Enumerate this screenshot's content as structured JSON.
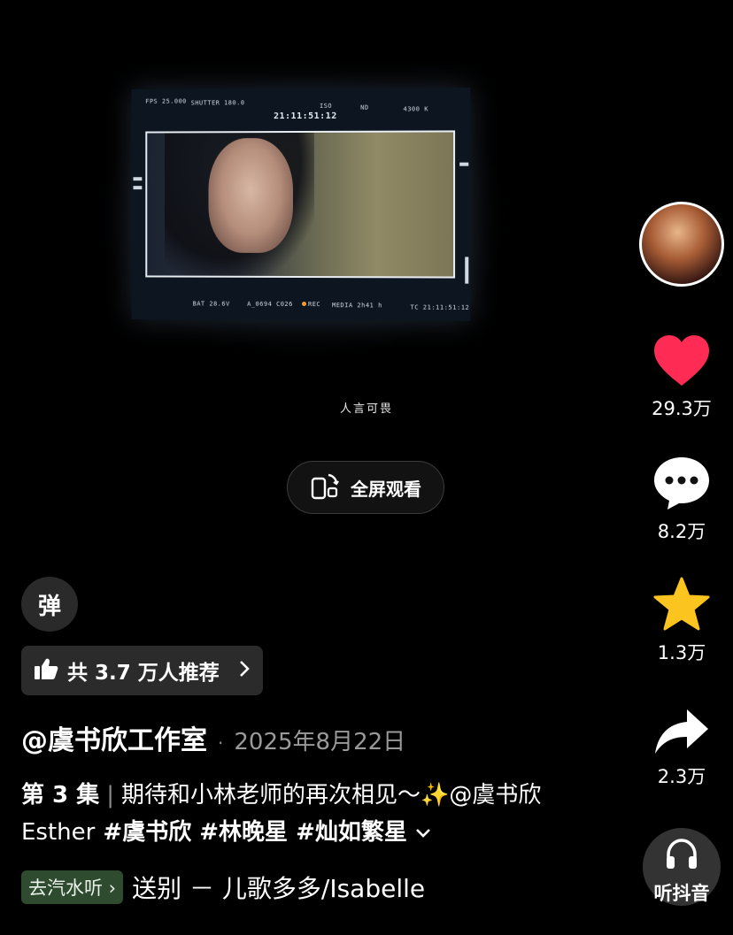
{
  "video": {
    "monitor": {
      "fps": "FPS 25.000",
      "shutter": "SHUTTER 180.0",
      "timecode_top": "21:11:51:12",
      "iso": "ISO",
      "nd": "ND",
      "wb": "4300 K",
      "bat": "BAT 28.6V",
      "clip": "A_0694 C026",
      "rec": "REC",
      "media": "MEDIA 2h41 h",
      "tc_bottom": "TC 21:11:51:12"
    },
    "subtitle": "人言可畏"
  },
  "fullscreen_button": {
    "label": "全屏观看"
  },
  "rail": {
    "likes": "29.3万",
    "comments": "8.2万",
    "favorites": "1.3万",
    "shares": "2.3万",
    "like_color": "#fe2c55",
    "favorite_color": "#fcc41f"
  },
  "danmu_label": "弹",
  "recommend": {
    "text": "共 3.7 万人推荐"
  },
  "author": {
    "name": "@虞书欣工作室",
    "date": "2025年8月22日"
  },
  "caption": {
    "episode": "第 3 集",
    "description": "期待和小林老师的再次相见～✨@虞书欣Esther",
    "tags": "#虞书欣 #林晚星 #灿如繁星"
  },
  "music": {
    "tag": "去汽水听",
    "title": "送别 － 儿歌多多/Isabelle"
  },
  "listen": {
    "label": "听抖音"
  }
}
